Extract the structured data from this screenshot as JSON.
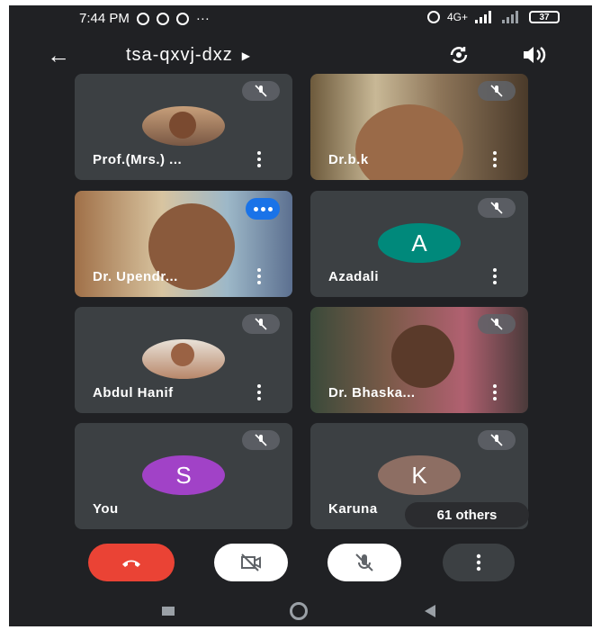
{
  "status_bar": {
    "time": "7:44 PM",
    "dots": "···",
    "network": "4G+",
    "battery": "37"
  },
  "app_bar": {
    "meeting_code": "tsa-qxvj-dxz",
    "icons": [
      "back-arrow-icon",
      "switch-camera-icon",
      "speaker-icon"
    ]
  },
  "participants": [
    {
      "name": "Prof.(Mrs.) ...",
      "type": "photo",
      "muted": true
    },
    {
      "name": "Dr.b.k",
      "type": "video",
      "muted": true
    },
    {
      "name": "Dr. Upendr...",
      "type": "video",
      "speaking": true
    },
    {
      "name": "Azadali",
      "type": "initial",
      "initial": "A",
      "color": "#00897b",
      "muted": true
    },
    {
      "name": "Abdul Hanif",
      "type": "photo",
      "muted": true
    },
    {
      "name": "Dr. Bhaska...",
      "type": "video",
      "muted": true
    },
    {
      "name": "You",
      "type": "initial",
      "initial": "S",
      "color": "#a142c7",
      "muted": true
    },
    {
      "name": "Karuna",
      "type": "initial",
      "initial": "K",
      "color": "#8d6e63",
      "muted": true
    }
  ],
  "others_pill": "61 others",
  "colors": {
    "background": "#202124",
    "tile": "#3c4043",
    "end_call": "#ea4335",
    "speaking": "#1a73e8"
  },
  "controls": [
    "end-call-button",
    "camera-off-button",
    "mic-off-button",
    "more-options-button"
  ],
  "nav_bar": [
    "recents-nav",
    "home-nav",
    "back-nav"
  ]
}
